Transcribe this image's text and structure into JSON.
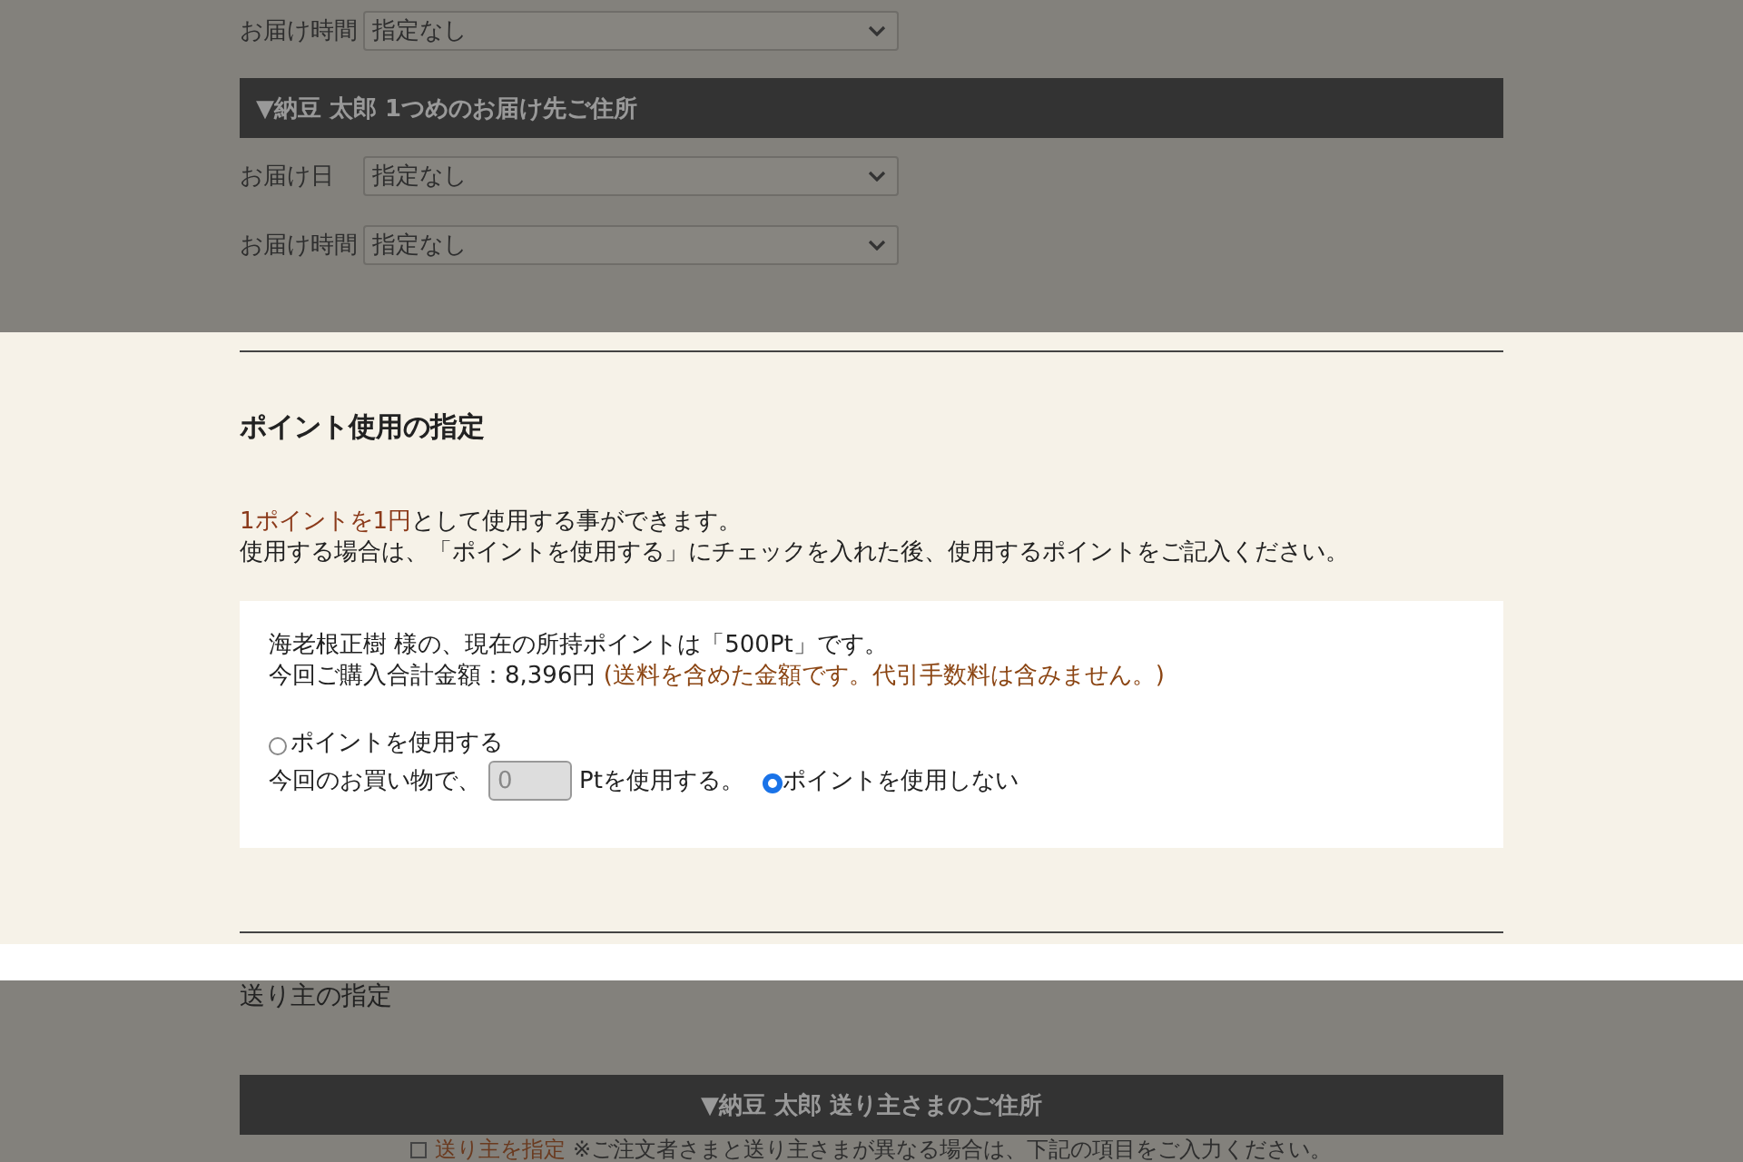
{
  "delivery": {
    "fields": [
      {
        "label": "お届け時間",
        "value": "指定なし"
      }
    ],
    "address_header": "▼納豆 太郎 1つめのお届け先ご住所",
    "address_fields": [
      {
        "label": "お届け日",
        "value": "指定なし"
      },
      {
        "label": "お届け時間",
        "value": "指定なし"
      }
    ]
  },
  "points": {
    "title": "ポイント使用の指定",
    "intro_highlight": "1ポイントを1円",
    "intro_rest": "として使用する事ができます。",
    "instruction": "使用する場合は、「ポイントを使用する」にチェックを入れた後、使用するポイントをご記入ください。",
    "holder_line": "海老根正樹 様の、現在の所持ポイントは「500Pt」です。",
    "total": "今回ご購入合計金額：8,396円",
    "total_note": "(送料を含めた金額です。代引手数料は含みません。)",
    "options": [
      {
        "label": "ポイントを使用する",
        "selected": false
      },
      {
        "label": "ポイントを使用しない",
        "selected": true
      }
    ],
    "amount_prefix": "今回のお買い物で、",
    "amount_value": "0",
    "amount_disabled": true,
    "amount_suffix": "Ptを使用する。"
  },
  "sender": {
    "title": "送り主の指定",
    "header": "▼納豆 太郎 送り主さまのご住所",
    "option": {
      "label": "送り主を指定",
      "checked": false
    },
    "note": "※ご注文者さまと送り主さまが異なる場合は、下記の項目をご入力ください。"
  }
}
